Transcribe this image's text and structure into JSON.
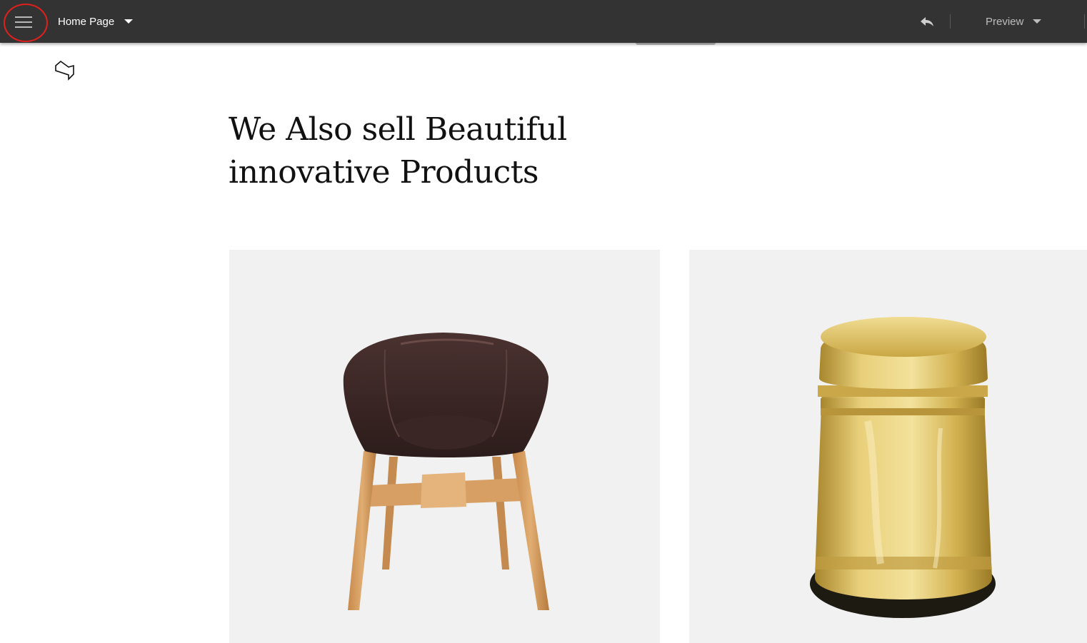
{
  "toolbar": {
    "page_name": "Home Page",
    "preview_label": "Preview"
  },
  "content": {
    "headline_line1": "We Also sell Beautiful",
    "headline_line2": "innovative Products"
  },
  "products": [
    {
      "name": "chair-image"
    },
    {
      "name": "brass-stool-image"
    }
  ],
  "colors": {
    "toolbar_bg": "#333333",
    "highlight": "#e0201c",
    "card_bg": "#f1f1f1"
  }
}
